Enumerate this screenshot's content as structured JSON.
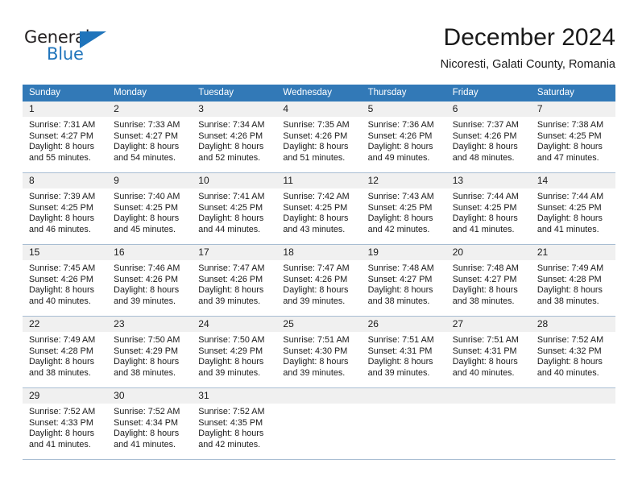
{
  "brand": {
    "name_part1": "General",
    "name_part2": "Blue",
    "triangle_color": "#1f74bb"
  },
  "header": {
    "title": "December 2024",
    "subtitle": "Nicoresti, Galati County, Romania"
  },
  "theme": {
    "header_bg": "#3279b7",
    "header_text": "#ffffff",
    "daynum_bg": "#f0f0f0",
    "cell_bg": "#ffffff",
    "row_divider": "#a8bdd2"
  },
  "weekdays": [
    "Sunday",
    "Monday",
    "Tuesday",
    "Wednesday",
    "Thursday",
    "Friday",
    "Saturday"
  ],
  "weeks": [
    {
      "days": [
        {
          "num": "1",
          "sunrise": "Sunrise: 7:31 AM",
          "sunset": "Sunset: 4:27 PM",
          "daylight1": "Daylight: 8 hours",
          "daylight2": "and 55 minutes."
        },
        {
          "num": "2",
          "sunrise": "Sunrise: 7:33 AM",
          "sunset": "Sunset: 4:27 PM",
          "daylight1": "Daylight: 8 hours",
          "daylight2": "and 54 minutes."
        },
        {
          "num": "3",
          "sunrise": "Sunrise: 7:34 AM",
          "sunset": "Sunset: 4:26 PM",
          "daylight1": "Daylight: 8 hours",
          "daylight2": "and 52 minutes."
        },
        {
          "num": "4",
          "sunrise": "Sunrise: 7:35 AM",
          "sunset": "Sunset: 4:26 PM",
          "daylight1": "Daylight: 8 hours",
          "daylight2": "and 51 minutes."
        },
        {
          "num": "5",
          "sunrise": "Sunrise: 7:36 AM",
          "sunset": "Sunset: 4:26 PM",
          "daylight1": "Daylight: 8 hours",
          "daylight2": "and 49 minutes."
        },
        {
          "num": "6",
          "sunrise": "Sunrise: 7:37 AM",
          "sunset": "Sunset: 4:26 PM",
          "daylight1": "Daylight: 8 hours",
          "daylight2": "and 48 minutes."
        },
        {
          "num": "7",
          "sunrise": "Sunrise: 7:38 AM",
          "sunset": "Sunset: 4:25 PM",
          "daylight1": "Daylight: 8 hours",
          "daylight2": "and 47 minutes."
        }
      ]
    },
    {
      "days": [
        {
          "num": "8",
          "sunrise": "Sunrise: 7:39 AM",
          "sunset": "Sunset: 4:25 PM",
          "daylight1": "Daylight: 8 hours",
          "daylight2": "and 46 minutes."
        },
        {
          "num": "9",
          "sunrise": "Sunrise: 7:40 AM",
          "sunset": "Sunset: 4:25 PM",
          "daylight1": "Daylight: 8 hours",
          "daylight2": "and 45 minutes."
        },
        {
          "num": "10",
          "sunrise": "Sunrise: 7:41 AM",
          "sunset": "Sunset: 4:25 PM",
          "daylight1": "Daylight: 8 hours",
          "daylight2": "and 44 minutes."
        },
        {
          "num": "11",
          "sunrise": "Sunrise: 7:42 AM",
          "sunset": "Sunset: 4:25 PM",
          "daylight1": "Daylight: 8 hours",
          "daylight2": "and 43 minutes."
        },
        {
          "num": "12",
          "sunrise": "Sunrise: 7:43 AM",
          "sunset": "Sunset: 4:25 PM",
          "daylight1": "Daylight: 8 hours",
          "daylight2": "and 42 minutes."
        },
        {
          "num": "13",
          "sunrise": "Sunrise: 7:44 AM",
          "sunset": "Sunset: 4:25 PM",
          "daylight1": "Daylight: 8 hours",
          "daylight2": "and 41 minutes."
        },
        {
          "num": "14",
          "sunrise": "Sunrise: 7:44 AM",
          "sunset": "Sunset: 4:25 PM",
          "daylight1": "Daylight: 8 hours",
          "daylight2": "and 41 minutes."
        }
      ]
    },
    {
      "days": [
        {
          "num": "15",
          "sunrise": "Sunrise: 7:45 AM",
          "sunset": "Sunset: 4:26 PM",
          "daylight1": "Daylight: 8 hours",
          "daylight2": "and 40 minutes."
        },
        {
          "num": "16",
          "sunrise": "Sunrise: 7:46 AM",
          "sunset": "Sunset: 4:26 PM",
          "daylight1": "Daylight: 8 hours",
          "daylight2": "and 39 minutes."
        },
        {
          "num": "17",
          "sunrise": "Sunrise: 7:47 AM",
          "sunset": "Sunset: 4:26 PM",
          "daylight1": "Daylight: 8 hours",
          "daylight2": "and 39 minutes."
        },
        {
          "num": "18",
          "sunrise": "Sunrise: 7:47 AM",
          "sunset": "Sunset: 4:26 PM",
          "daylight1": "Daylight: 8 hours",
          "daylight2": "and 39 minutes."
        },
        {
          "num": "19",
          "sunrise": "Sunrise: 7:48 AM",
          "sunset": "Sunset: 4:27 PM",
          "daylight1": "Daylight: 8 hours",
          "daylight2": "and 38 minutes."
        },
        {
          "num": "20",
          "sunrise": "Sunrise: 7:48 AM",
          "sunset": "Sunset: 4:27 PM",
          "daylight1": "Daylight: 8 hours",
          "daylight2": "and 38 minutes."
        },
        {
          "num": "21",
          "sunrise": "Sunrise: 7:49 AM",
          "sunset": "Sunset: 4:28 PM",
          "daylight1": "Daylight: 8 hours",
          "daylight2": "and 38 minutes."
        }
      ]
    },
    {
      "days": [
        {
          "num": "22",
          "sunrise": "Sunrise: 7:49 AM",
          "sunset": "Sunset: 4:28 PM",
          "daylight1": "Daylight: 8 hours",
          "daylight2": "and 38 minutes."
        },
        {
          "num": "23",
          "sunrise": "Sunrise: 7:50 AM",
          "sunset": "Sunset: 4:29 PM",
          "daylight1": "Daylight: 8 hours",
          "daylight2": "and 38 minutes."
        },
        {
          "num": "24",
          "sunrise": "Sunrise: 7:50 AM",
          "sunset": "Sunset: 4:29 PM",
          "daylight1": "Daylight: 8 hours",
          "daylight2": "and 39 minutes."
        },
        {
          "num": "25",
          "sunrise": "Sunrise: 7:51 AM",
          "sunset": "Sunset: 4:30 PM",
          "daylight1": "Daylight: 8 hours",
          "daylight2": "and 39 minutes."
        },
        {
          "num": "26",
          "sunrise": "Sunrise: 7:51 AM",
          "sunset": "Sunset: 4:31 PM",
          "daylight1": "Daylight: 8 hours",
          "daylight2": "and 39 minutes."
        },
        {
          "num": "27",
          "sunrise": "Sunrise: 7:51 AM",
          "sunset": "Sunset: 4:31 PM",
          "daylight1": "Daylight: 8 hours",
          "daylight2": "and 40 minutes."
        },
        {
          "num": "28",
          "sunrise": "Sunrise: 7:52 AM",
          "sunset": "Sunset: 4:32 PM",
          "daylight1": "Daylight: 8 hours",
          "daylight2": "and 40 minutes."
        }
      ]
    },
    {
      "days": [
        {
          "num": "29",
          "sunrise": "Sunrise: 7:52 AM",
          "sunset": "Sunset: 4:33 PM",
          "daylight1": "Daylight: 8 hours",
          "daylight2": "and 41 minutes."
        },
        {
          "num": "30",
          "sunrise": "Sunrise: 7:52 AM",
          "sunset": "Sunset: 4:34 PM",
          "daylight1": "Daylight: 8 hours",
          "daylight2": "and 41 minutes."
        },
        {
          "num": "31",
          "sunrise": "Sunrise: 7:52 AM",
          "sunset": "Sunset: 4:35 PM",
          "daylight1": "Daylight: 8 hours",
          "daylight2": "and 42 minutes."
        },
        {
          "num": "",
          "sunrise": "",
          "sunset": "",
          "daylight1": "",
          "daylight2": ""
        },
        {
          "num": "",
          "sunrise": "",
          "sunset": "",
          "daylight1": "",
          "daylight2": ""
        },
        {
          "num": "",
          "sunrise": "",
          "sunset": "",
          "daylight1": "",
          "daylight2": ""
        },
        {
          "num": "",
          "sunrise": "",
          "sunset": "",
          "daylight1": "",
          "daylight2": ""
        }
      ]
    }
  ]
}
